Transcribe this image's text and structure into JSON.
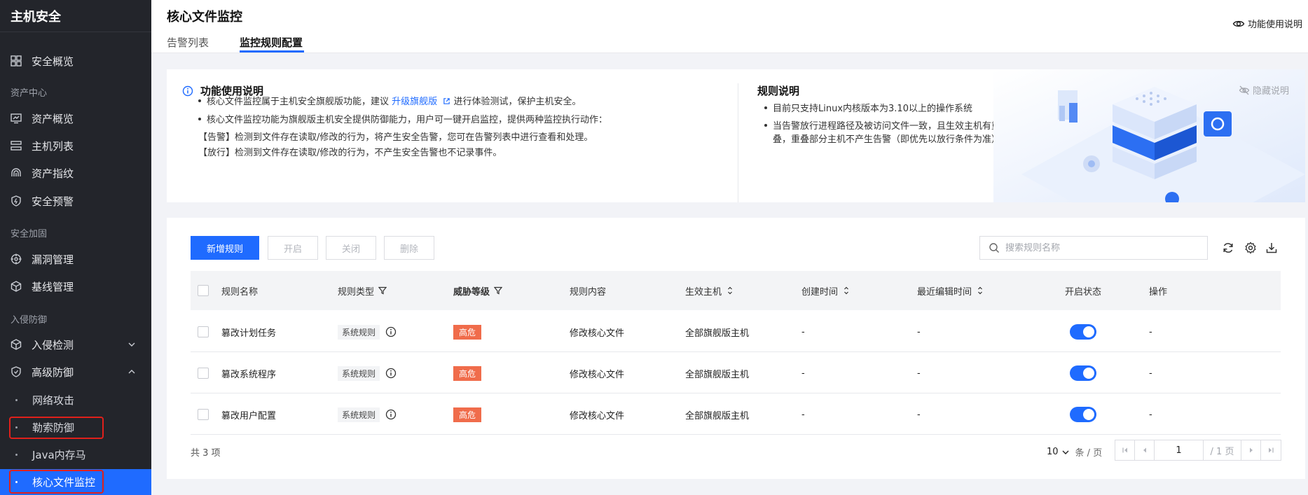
{
  "sidebar": {
    "title": "主机安全",
    "overview": "安全概览",
    "sections": {
      "asset_center": "资产中心",
      "security_hardening": "安全加固",
      "intrusion_defense": "入侵防御"
    },
    "asset_items": [
      "资产概览",
      "主机列表",
      "资产指纹",
      "安全预警"
    ],
    "hardening_items": [
      "漏洞管理",
      "基线管理"
    ],
    "intrusion_items": [
      "入侵检测",
      "高级防御"
    ],
    "advanced_sub": [
      "网络攻击",
      "勒索防御",
      "Java内存马",
      "核心文件监控"
    ]
  },
  "header": {
    "title": "核心文件监控",
    "tabs": [
      "告警列表",
      "监控规则配置"
    ],
    "active_tab": "监控规则配置",
    "help_link": "功能使用说明"
  },
  "info": {
    "title": "功能使用说明",
    "line1_pre": "核心文件监控属于主机安全旗舰版功能，建议",
    "line1_link": "升级旗舰版",
    "line1_post": "进行体验测试，保护主机安全。",
    "line2": "核心文件监控功能为旗舰版主机安全提供防御能力，用户可一键开启监控，提供两种监控执行动作：",
    "line3": "【告警】检测到文件存在读取/修改的行为，将产生安全告警，您可在告警列表中进行查看和处理。",
    "line4": "【放行】检测到文件存在读取/修改的行为，不产生安全告警也不记录事件。",
    "rule_title": "规则说明",
    "rule1": "目前只支持Linux内核版本为3.10以上的操作系统",
    "rule2a": "当告警放行进程路径及被访问文件一致，且生效主机有重",
    "rule2b": "叠，重叠部分主机不产生告警（即优先以放行条件为准）。",
    "hide": "隐藏说明"
  },
  "toolbar": {
    "add": "新增规则",
    "enable": "开启",
    "disable": "关闭",
    "delete": "删除",
    "search_placeholder": "搜索规则名称"
  },
  "table": {
    "headers": [
      "规则名称",
      "规则类型",
      "威胁等级",
      "规则内容",
      "生效主机",
      "创建时间",
      "最近编辑时间",
      "开启状态",
      "操作"
    ],
    "rows": [
      {
        "name": "篡改计划任务",
        "type": "系统规则",
        "level": "高危",
        "content": "修改核心文件",
        "hosts": "全部旗舰版主机",
        "created": "-",
        "edited": "-",
        "enabled": true,
        "op": "-"
      },
      {
        "name": "篡改系统程序",
        "type": "系统规则",
        "level": "高危",
        "content": "修改核心文件",
        "hosts": "全部旗舰版主机",
        "created": "-",
        "edited": "-",
        "enabled": true,
        "op": "-"
      },
      {
        "name": "篡改用户配置",
        "type": "系统规则",
        "level": "高危",
        "content": "修改核心文件",
        "hosts": "全部旗舰版主机",
        "created": "-",
        "edited": "-",
        "enabled": true,
        "op": "-"
      }
    ]
  },
  "pagination": {
    "total": "共 3 项",
    "page_size": "10",
    "unit": "条 / 页",
    "current_page": "1",
    "total_pages": "/ 1 页"
  },
  "colors": {
    "primary": "#1f6bff",
    "sidebar_bg": "#23252b",
    "danger": "#f06c4b",
    "highlight_box": "#e0201b"
  }
}
